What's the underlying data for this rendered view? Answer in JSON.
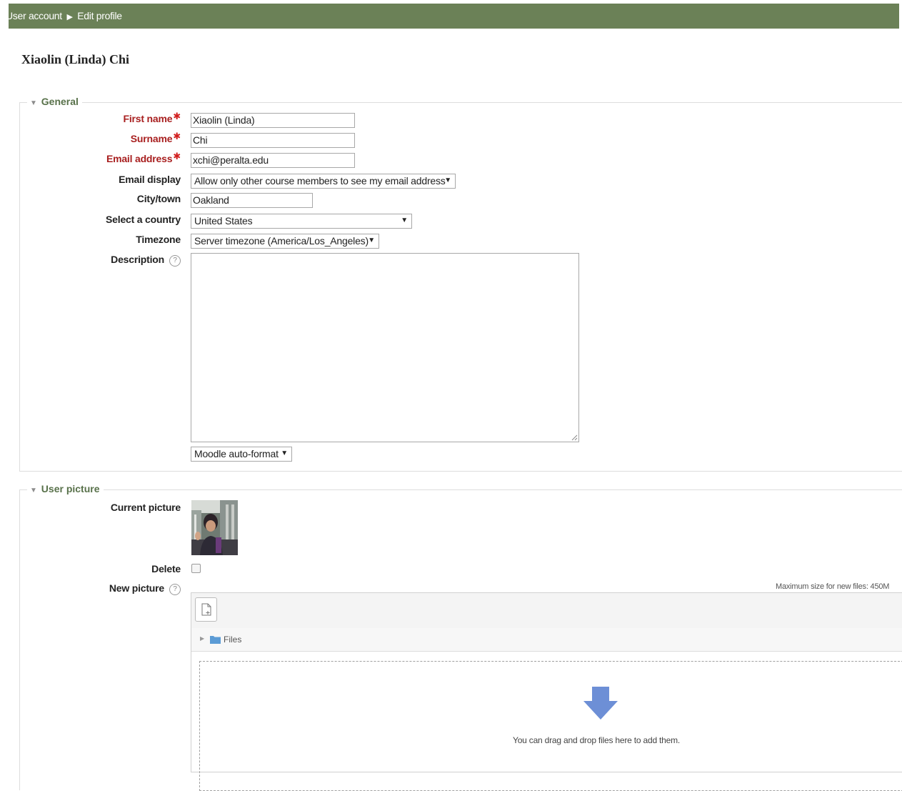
{
  "breadcrumb": {
    "parent": "User account",
    "separator": "▶",
    "current": "Edit profile"
  },
  "page_title": "Xiaolin (Linda) Chi",
  "sections": {
    "general": "General",
    "user_picture": "User picture"
  },
  "fields": {
    "first_name": {
      "label": "First name",
      "value": "Xiaolin (Linda)",
      "required": true
    },
    "surname": {
      "label": "Surname",
      "value": "Chi",
      "required": true
    },
    "email": {
      "label": "Email address",
      "value": "xchi@peralta.edu",
      "required": true
    },
    "email_display": {
      "label": "Email display",
      "selected": "Allow only other course members to see my email address"
    },
    "city": {
      "label": "City/town",
      "value": "Oakland"
    },
    "country": {
      "label": "Select a country",
      "selected": "United States"
    },
    "timezone": {
      "label": "Timezone",
      "selected": "Server timezone (America/Los_Angeles)"
    },
    "description": {
      "label": "Description",
      "value": "",
      "format": "Moodle auto-format"
    }
  },
  "picture": {
    "current_label": "Current picture",
    "delete_label": "Delete",
    "delete_checked": false,
    "new_label": "New picture",
    "max_size": "Maximum size for new files: 450M",
    "files_label": "Files",
    "drop_text": "You can drag and drop files here to add them."
  },
  "icons": {
    "required": "asterisk-icon",
    "help": "question-circle-icon",
    "collapse": "triangle-down-icon",
    "folder": "folder-icon",
    "add_file": "file-add-icon",
    "drop": "arrow-down-icon"
  },
  "colors": {
    "header_bg": "#6b8157",
    "legend": "#58714a",
    "required_label": "#a81f1f",
    "drop_arrow": "#6d8fd6"
  }
}
